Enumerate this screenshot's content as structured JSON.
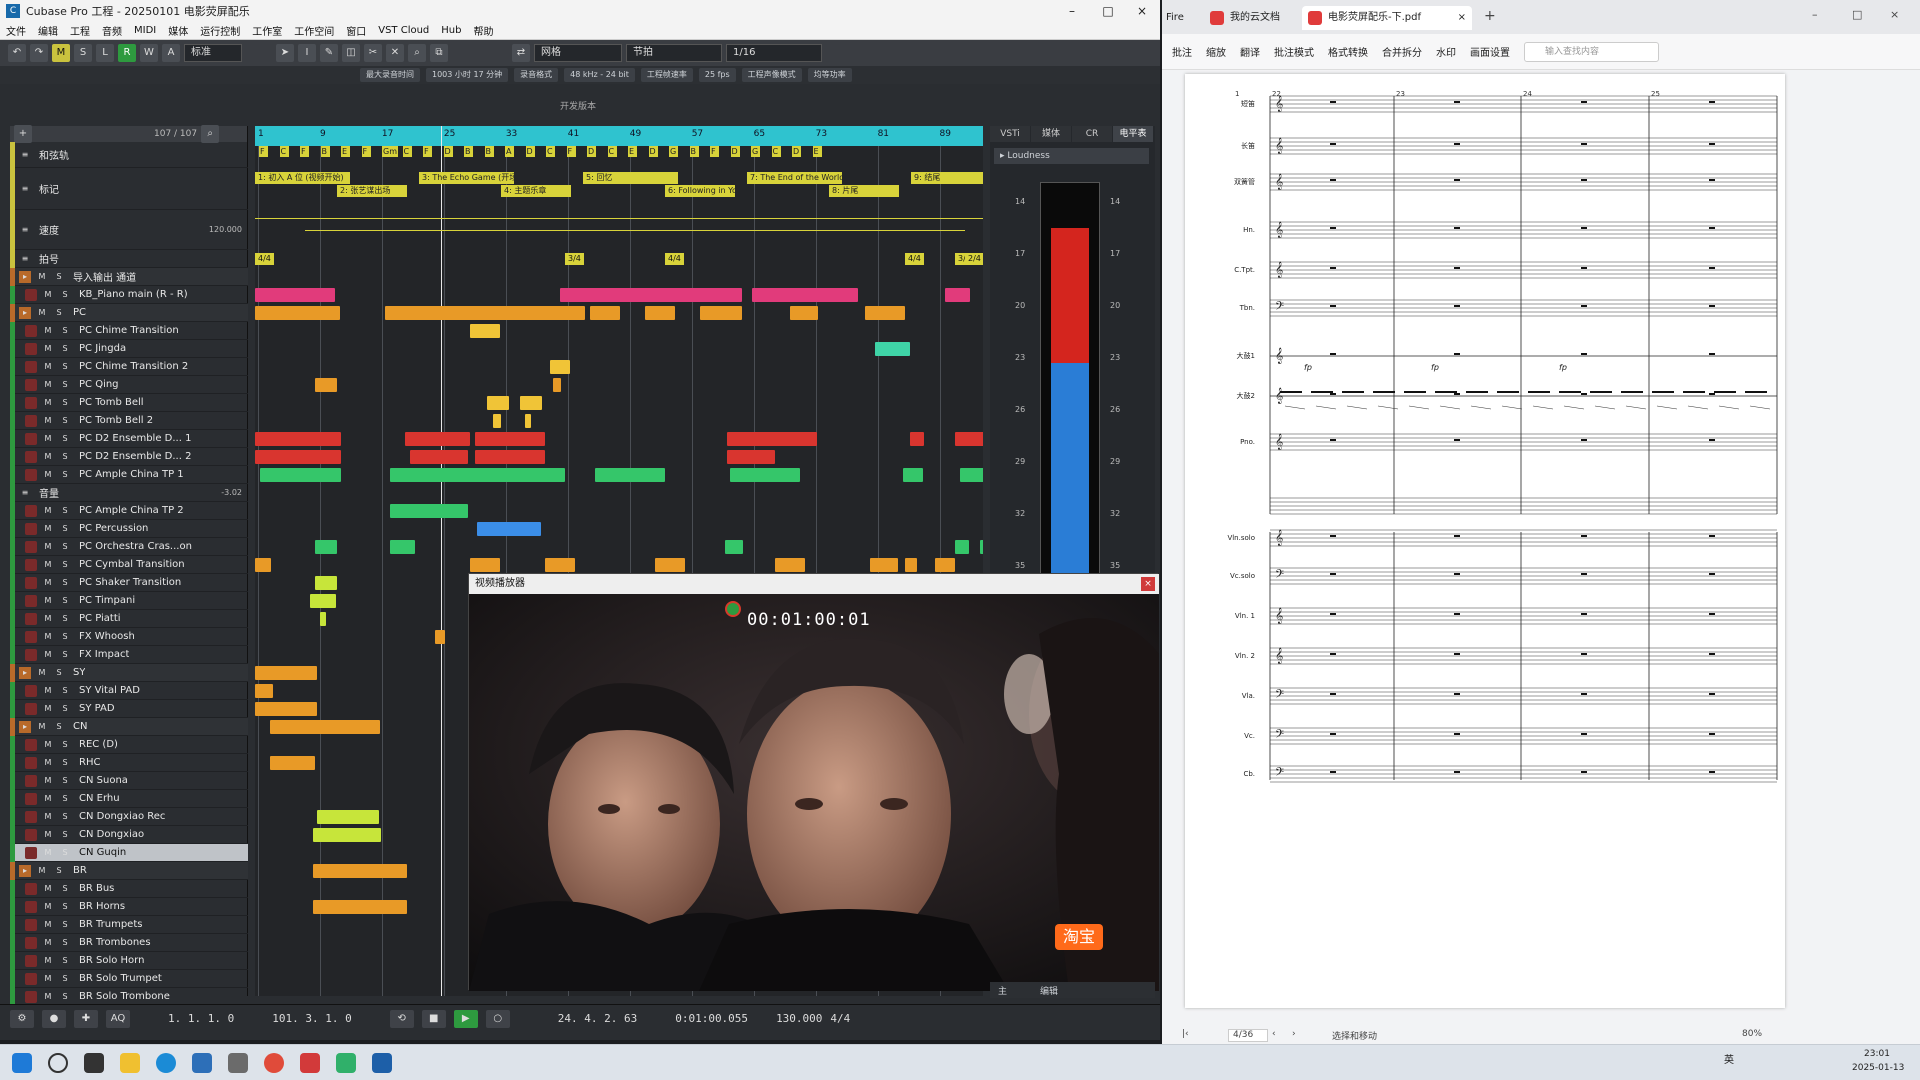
{
  "cubase": {
    "title": "Cubase Pro 工程 - 20250101 电影荧屏配乐",
    "menu": [
      "文件",
      "编辑",
      "工程",
      "音频",
      "MIDI",
      "媒体",
      "运行控制",
      "工作室",
      "工作空间",
      "窗口",
      "VST Cloud",
      "Hub",
      "帮助"
    ],
    "toolbar": {
      "mode_letters": [
        "M",
        "S",
        "L",
        "R",
        "W",
        "A"
      ],
      "snap_label": "网格",
      "quantize": "1/16",
      "grid": "节拍",
      "preset": "标准"
    },
    "info": [
      "最大录音时间",
      "1003 小时 17 分钟",
      "录音格式",
      "48 kHz - 24 bit",
      "工程帧速率",
      "25 fps",
      "工程声像模式",
      "均等功率"
    ],
    "sub_label": "开发版本",
    "track_count": "107 / 107",
    "ruler": [
      "1",
      "9",
      "17",
      "25",
      "33",
      "41",
      "49",
      "57",
      "65",
      "73",
      "81",
      "89"
    ],
    "right_tabs": [
      "VSTi",
      "媒体",
      "CR",
      "电平表"
    ],
    "loudness_label": "Loudness",
    "meter_scale": [
      "14",
      "17",
      "20",
      "23",
      "26",
      "29",
      "32",
      "35"
    ],
    "tracks": [
      {
        "n": "",
        "name": "和弦轨",
        "type": "chord"
      },
      {
        "n": "",
        "name": "标记",
        "type": "marker"
      },
      {
        "n": "",
        "name": "速度",
        "type": "tempo",
        "value": "120.000"
      },
      {
        "n": "",
        "name": "拍号",
        "type": "sig"
      },
      {
        "n": "",
        "name": "导入输出 通道",
        "type": "folder"
      },
      {
        "n": "",
        "name": "KB_Piano main (R - R)",
        "type": "inst"
      },
      {
        "n": "",
        "name": "PC",
        "type": "folder"
      },
      {
        "n": "6",
        "name": "PC Chime Transition",
        "type": "inst"
      },
      {
        "n": "7",
        "name": "PC Jingda",
        "type": "inst"
      },
      {
        "n": "8",
        "name": "PC Chime Transition 2",
        "type": "inst"
      },
      {
        "n": "9",
        "name": "PC Qing",
        "type": "inst"
      },
      {
        "n": "10",
        "name": "PC Tomb Bell",
        "type": "inst"
      },
      {
        "n": "11",
        "name": "PC Tomb Bell 2",
        "type": "inst"
      },
      {
        "n": "12",
        "name": "PC D2 Ensemble D... 1",
        "type": "inst"
      },
      {
        "n": "13",
        "name": "PC D2 Ensemble D... 2",
        "type": "inst"
      },
      {
        "n": "14",
        "name": "PC Ample China TP 1",
        "type": "inst"
      },
      {
        "n": "",
        "name": "音量",
        "type": "auto",
        "value": "-3.02"
      },
      {
        "n": "15",
        "name": "PC Ample China TP 2",
        "type": "inst"
      },
      {
        "n": "16",
        "name": "PC Percussion",
        "type": "inst"
      },
      {
        "n": "17",
        "name": "PC Orchestra Cras...on",
        "type": "inst"
      },
      {
        "n": "18",
        "name": "PC Cymbal Transition",
        "type": "inst"
      },
      {
        "n": "19",
        "name": "PC Shaker Transition",
        "type": "inst"
      },
      {
        "n": "20",
        "name": "PC Timpani",
        "type": "inst"
      },
      {
        "n": "21",
        "name": "PC Piatti",
        "type": "inst"
      },
      {
        "n": "22",
        "name": "FX Whoosh",
        "type": "inst"
      },
      {
        "n": "23",
        "name": "FX Impact",
        "type": "inst"
      },
      {
        "n": "",
        "name": "SY",
        "type": "folder"
      },
      {
        "n": "24",
        "name": "SY Vital PAD",
        "type": "inst"
      },
      {
        "n": "25",
        "name": "SY PAD",
        "type": "inst"
      },
      {
        "n": "",
        "name": "CN",
        "type": "folder"
      },
      {
        "n": "26",
        "name": "REC (D)",
        "type": "inst"
      },
      {
        "n": "27",
        "name": "RHC",
        "type": "inst"
      },
      {
        "n": "28",
        "name": "CN Suona",
        "type": "inst"
      },
      {
        "n": "29",
        "name": "CN Erhu",
        "type": "inst"
      },
      {
        "n": "30",
        "name": "CN Dongxiao Rec",
        "type": "inst"
      },
      {
        "n": "31",
        "name": "CN Dongxiao",
        "type": "inst"
      },
      {
        "n": "32",
        "name": "CN Guqin",
        "type": "inst",
        "selected": true
      },
      {
        "n": "",
        "name": "BR",
        "type": "folder"
      },
      {
        "n": "",
        "name": "BR Bus",
        "type": "inst"
      },
      {
        "n": "",
        "name": "BR Horns",
        "type": "inst"
      },
      {
        "n": "",
        "name": "BR Trumpets",
        "type": "inst"
      },
      {
        "n": "",
        "name": "BR Trombones",
        "type": "inst"
      },
      {
        "n": "",
        "name": "BR Solo Horn",
        "type": "inst"
      },
      {
        "n": "",
        "name": "BR Solo Trumpet",
        "type": "inst"
      },
      {
        "n": "",
        "name": "BR Solo Trombone",
        "type": "inst"
      }
    ],
    "markers": [
      "1: 初入 A 位 (视频开始)",
      "2: 张艺谋出场",
      "3: The Echo Game (开场)",
      "4: 主题乐章",
      "5: 回忆",
      "6: Following in Your Footsteps",
      "7: The End of the World 结束",
      "8: 片尾",
      "9: 结尾"
    ],
    "chords": [
      "F",
      "C",
      "F",
      "B",
      "E",
      "F",
      "Gm",
      "C",
      "F",
      "D",
      "B",
      "B",
      "A",
      "D",
      "C",
      "F",
      "D",
      "C",
      "E",
      "D",
      "G",
      "B",
      "F",
      "D",
      "G",
      "C",
      "D",
      "E"
    ],
    "signatures": [
      "4/4",
      "3/4",
      "4/4",
      "4/4",
      "3/4",
      "2/4"
    ],
    "transport": {
      "left_locator": "1. 1. 1.  0",
      "right_locator": "101. 3. 1.  0",
      "position_bars": "24. 4. 2. 63",
      "position_time": "0:01:00.055",
      "tempo": "130.000",
      "signature": "4/4"
    },
    "lower_tabs": [
      "主",
      "编辑"
    ]
  },
  "video": {
    "title": "视频播放器",
    "timecode": "00:01:00:01",
    "badge": "淘宝"
  },
  "pdf": {
    "tabs": [
      "Fire",
      "我的云文档",
      "电影荧屏配乐-下.pdf"
    ],
    "tools": [
      "批注",
      "缩放",
      "翻译",
      "批注模式",
      "格式转换",
      "合并拆分",
      "水印",
      "画面设置"
    ],
    "search_placeholder": "输入查找内容",
    "bar_numbers": [
      "22",
      "23",
      "24",
      "25"
    ],
    "system_start": "1",
    "staves": [
      "短笛",
      "长笛",
      "双簧管",
      "Hn.",
      "C.Tpt.",
      "Tbn.",
      "大鼓1",
      "大鼓2",
      "Pno.",
      "Vln.solo",
      "Vc.solo",
      "Vln. 1",
      "Vln. 2",
      "Vla.",
      "Vc.",
      "Cb."
    ],
    "dynamics": [
      "fp",
      "fp",
      "fp"
    ],
    "page_indicator": "4/36",
    "zoom": "80%",
    "status_text": "选择和移动"
  },
  "taskbar": {
    "time": "23:01",
    "date": "2025-01-13",
    "lang": "英"
  },
  "colors": {
    "ruler": "#2fc3cf",
    "pink": "#e13b7b",
    "orange": "#e89a27",
    "yellow": "#f0c437",
    "red": "#d9352f",
    "green": "#35c66a",
    "teal": "#3fd4a7",
    "blue": "#3b8ee8",
    "lime": "#c7e53a",
    "marker": "#d8d33a",
    "meterRed": "#d4251e",
    "meterBlue": "#2a7dd6"
  }
}
